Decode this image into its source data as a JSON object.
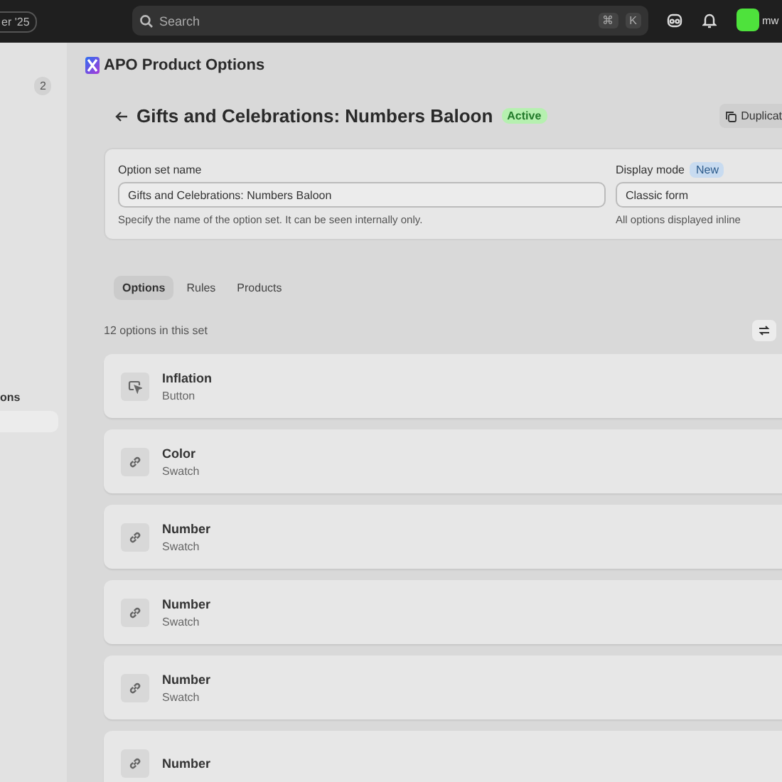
{
  "topbar": {
    "badge": "er '25",
    "search": {
      "placeholder": "Search"
    },
    "shortcut_keys": [
      "⌘",
      "K"
    ],
    "user": "mw"
  },
  "sidebar": {
    "count": "2",
    "section_label": "ons"
  },
  "app": {
    "title": "APO Product Options"
  },
  "header": {
    "title": "Gifts and Celebrations: Numbers Baloon",
    "status": "Active",
    "duplicate_button": "Duplicat"
  },
  "settings": {
    "name_label": "Option set name",
    "name_value": "Gifts and Celebrations: Numbers Baloon",
    "name_help": "Specify the name of the option set. It can be seen internally only.",
    "mode_label": "Display mode",
    "mode_badge": "New",
    "mode_value": "Classic form",
    "mode_help": "All options displayed inline"
  },
  "tabs": [
    {
      "label": "Options",
      "selected": true
    },
    {
      "label": "Rules",
      "selected": false
    },
    {
      "label": "Products",
      "selected": false
    }
  ],
  "options_count": "12 options in this set",
  "options": [
    {
      "kind": "button",
      "title": "Inflation",
      "subtitle": "Button"
    },
    {
      "kind": "swatch",
      "title": "Color",
      "subtitle": "Swatch"
    },
    {
      "kind": "swatch",
      "title": "Number",
      "subtitle": "Swatch"
    },
    {
      "kind": "swatch",
      "title": "Number",
      "subtitle": "Swatch"
    },
    {
      "kind": "swatch",
      "title": "Number",
      "subtitle": "Swatch"
    },
    {
      "kind": "swatch",
      "title": "Number"
    }
  ]
}
